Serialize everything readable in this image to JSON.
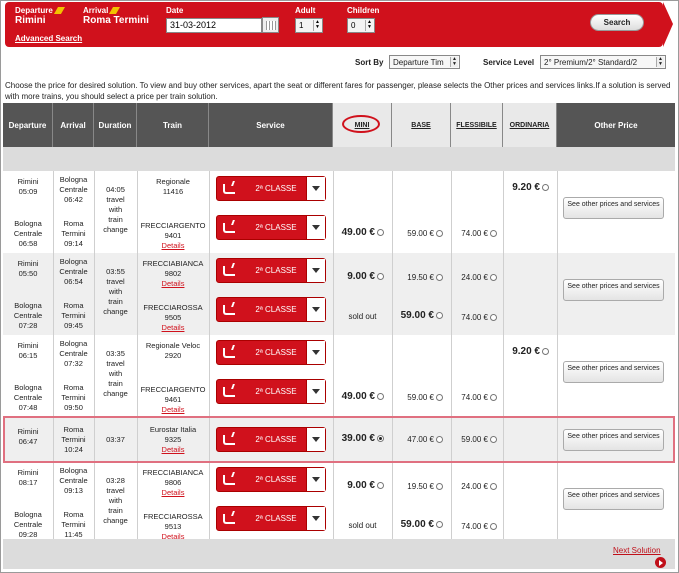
{
  "search": {
    "departure_label": "Departure",
    "departure_value": "Rimini",
    "arrival_label": "Arrival",
    "arrival_value": "Roma Termini",
    "date_label": "Date",
    "date_value": "31-03-2012",
    "adult_label": "Adult",
    "adult_value": "1",
    "children_label": "Children",
    "children_value": "0",
    "advanced_link": "Advanced Search",
    "search_button": "Search"
  },
  "sort": {
    "sort_label": "Sort By",
    "sort_value": "Departure Tim",
    "service_level_label": "Service Level",
    "service_level_value": "2° Premium/2° Standard/2"
  },
  "instructions": "Choose the price for desired solution. To view and buy other services, apart the seat or different fares for passenger, please selects the Other prices and services links.If a solution is served with more trains, you should select a price per train solution.",
  "columns": [
    "Departure",
    "Arrival",
    "Duration",
    "Train",
    "Service",
    "MINI",
    "BASE",
    "FLESSIBILE",
    "ORDINARIA",
    "Other Price"
  ],
  "service_label": "2ª CLASSE",
  "details_label": "Details",
  "sold_out": "sold out",
  "other_button": "See other prices and services",
  "solutions": [
    {
      "duration": "04:05 travel with train change",
      "legs": [
        {
          "dep": "Rimini 05:09",
          "arr": "Bologna Centrale 06:42",
          "train": "Regionale 11416",
          "details": false
        },
        {
          "dep": "Bologna Centrale 06:58",
          "arr": "Roma Termini 09:14",
          "train": "FRECCIARGENTO 9401",
          "details": true
        }
      ],
      "ordinaria": "9.20 €",
      "mini": "49.00 €",
      "base": "59.00 €",
      "flessibile": "74.00 €"
    },
    {
      "duration": "03:55 travel with train change",
      "legs": [
        {
          "dep": "Rimini 05:50",
          "arr": "Bologna Centrale 06:54",
          "train": "FRECCIABIANCA 9802",
          "details": true
        },
        {
          "dep": "Bologna Centrale 07:28",
          "arr": "Roma Termini 09:45",
          "train": "FRECCIAROSSA 9505",
          "details": true
        }
      ],
      "mini_leg1": "9.00 €",
      "base_leg1": "19.50 €",
      "flessibile_leg1": "24.00 €",
      "mini_leg2": "sold out",
      "base_leg2": "59.00 €",
      "flessibile_leg2": "74.00 €"
    },
    {
      "duration": "03:35 travel with train change",
      "legs": [
        {
          "dep": "Rimini 06:15",
          "arr": "Bologna Centrale 07:32",
          "train": "Regionale Veloc 2920",
          "details": false
        },
        {
          "dep": "Bologna Centrale 07:48",
          "arr": "Roma Termini 09:50",
          "train": "FRECCIARGENTO 9461",
          "details": true
        }
      ],
      "ordinaria": "9.20 €",
      "mini": "49.00 €",
      "base": "59.00 €",
      "flessibile": "74.00 €"
    },
    {
      "duration": "03:37",
      "legs": [
        {
          "dep": "Rimini 06:47",
          "arr": "Roma Termini 10:24",
          "train": "Eurostar Italia 9325",
          "details": true
        }
      ],
      "mini": "39.00 €",
      "base": "47.00 €",
      "flessibile": "59.00 €"
    },
    {
      "duration": "03:28 travel with train change",
      "legs": [
        {
          "dep": "Rimini 08:17",
          "arr": "Bologna Centrale 09:13",
          "train": "FRECCIABIANCA 9806",
          "details": true
        },
        {
          "dep": "Bologna Centrale 09:28",
          "arr": "Roma Termini 11:45",
          "train": "FRECCIAROSSA 9513",
          "details": true
        }
      ],
      "mini_leg1": "9.00 €",
      "base_leg1": "19.50 €",
      "flessibile_leg1": "24.00 €",
      "mini_leg2": "sold out",
      "base_leg2": "59.00 €",
      "flessibile_leg2": "74.00 €"
    }
  ],
  "next_solution": "Next Solution",
  "colors": {
    "brand_red": "#d0111c",
    "header_dark": "#555555",
    "band_grey": "#dcdcdc",
    "highlight": "#e07080"
  }
}
